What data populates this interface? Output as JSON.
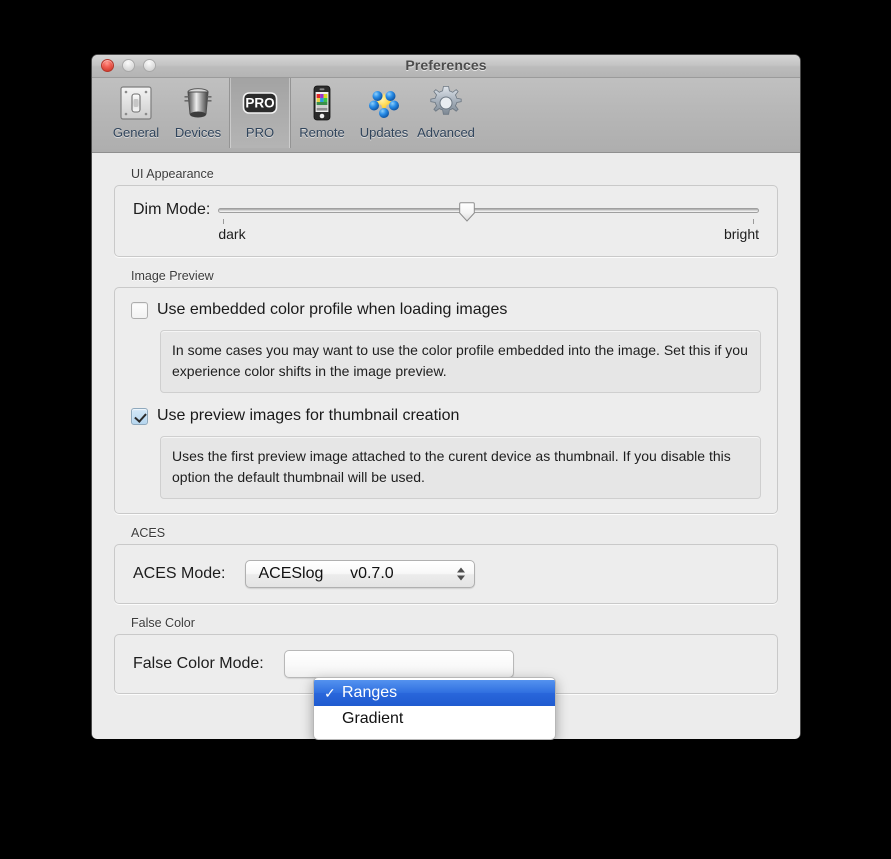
{
  "window": {
    "title": "Preferences",
    "traffic_lights": [
      "close",
      "minimize",
      "zoom"
    ]
  },
  "toolbar": {
    "items": [
      {
        "label": "General",
        "icon": "switch-plate-icon",
        "selected": false
      },
      {
        "label": "Devices",
        "icon": "device-cylinder-icon",
        "selected": false
      },
      {
        "label": "PRO",
        "icon": "pro-badge-icon",
        "selected": true
      },
      {
        "label": "Remote",
        "icon": "phone-colorchart-icon",
        "selected": false
      },
      {
        "label": "Updates",
        "icon": "spheres-star-icon",
        "selected": false
      },
      {
        "label": "Advanced",
        "icon": "gear-icon",
        "selected": false
      }
    ]
  },
  "sections": {
    "ui_appearance": {
      "group_label": "UI Appearance",
      "dim_mode_label": "Dim Mode:",
      "slider_value": 50,
      "slider_min": 0,
      "slider_max": 100,
      "tick_left_label": "dark",
      "tick_right_label": "bright"
    },
    "image_preview": {
      "group_label": "Image Preview",
      "option_color_profile": {
        "label": "Use embedded color profile when loading images",
        "checked": false,
        "description": "In some cases you may want to use the color profile embedded into the image. Set this if you experience color shifts in the image preview."
      },
      "option_preview_thumbnail": {
        "label": "Use preview images for thumbnail creation",
        "checked": true,
        "description": "Uses the first preview image attached to the curent device as thumbnail. If you disable this option the default thumbnail will be used."
      }
    },
    "aces": {
      "group_label": "ACES",
      "field_label": "ACES Mode:",
      "selected_value": "ACESlog      v0.7.0"
    },
    "false_color": {
      "group_label": "False Color",
      "field_label": "False Color Mode:",
      "selected_value": "Ranges",
      "menu_open": true,
      "options": [
        {
          "label": "Ranges",
          "checked": true,
          "highlighted": true
        },
        {
          "label": "Gradient",
          "checked": false,
          "highlighted": false
        }
      ],
      "checkmark_glyph": "✓"
    }
  },
  "colors": {
    "window_body": "#ececec",
    "toolbar": "#b6b6b6",
    "titlebar": "#c3c3c3",
    "menu_highlight": "#2f6fe0",
    "tab_label": "#31455c",
    "desktop": "#000000"
  }
}
